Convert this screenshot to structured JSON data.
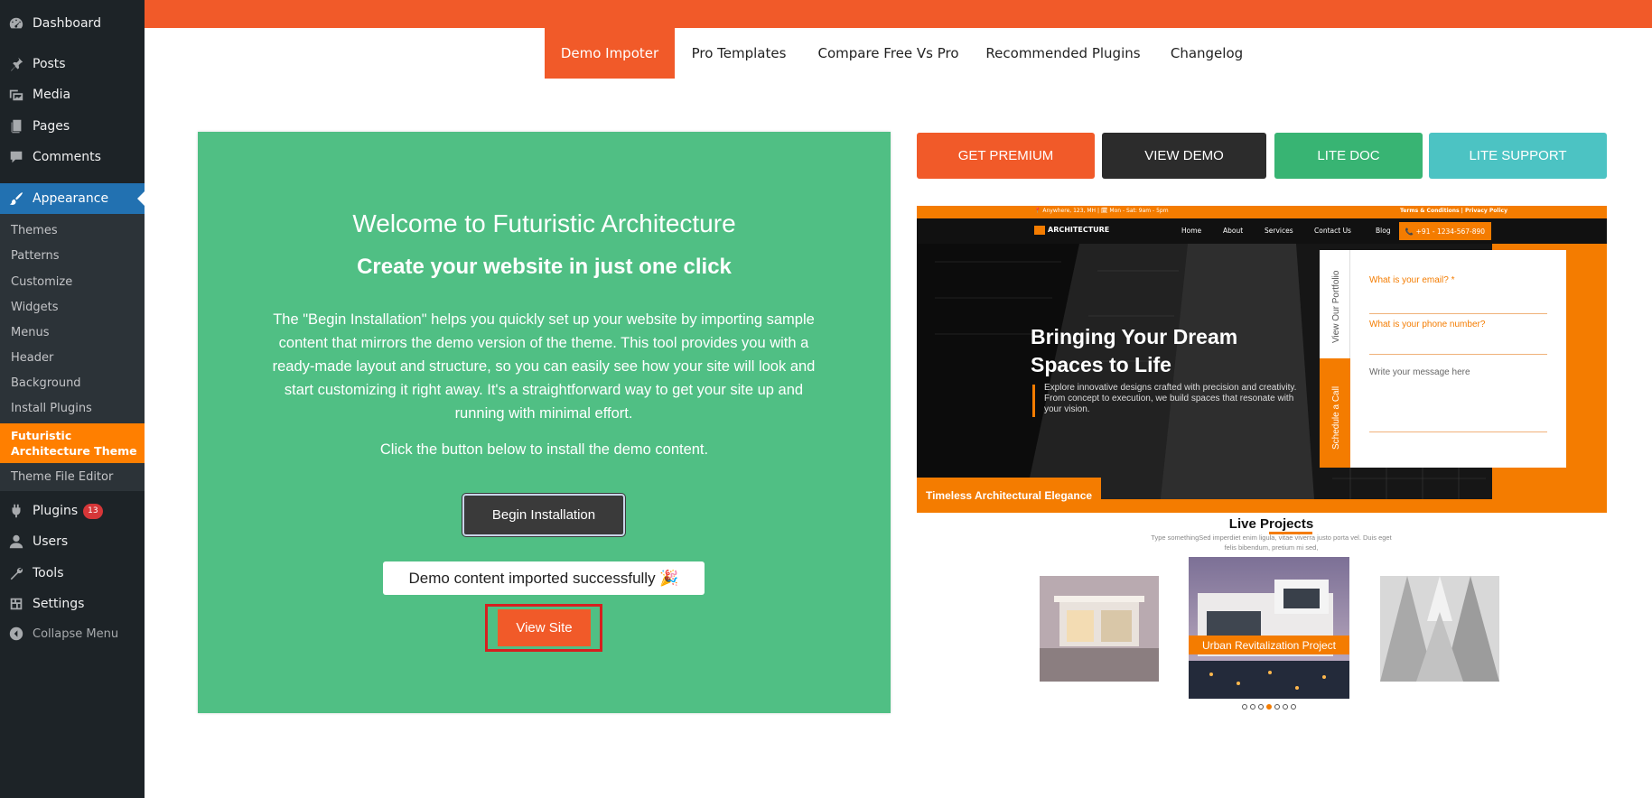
{
  "sidebar": {
    "items": [
      {
        "label": "Dashboard",
        "icon": "dashboard-icon"
      },
      {
        "label": "Posts",
        "icon": "pin-icon"
      },
      {
        "label": "Media",
        "icon": "media-icon"
      },
      {
        "label": "Pages",
        "icon": "pages-icon"
      },
      {
        "label": "Comments",
        "icon": "comment-icon"
      },
      {
        "label": "Appearance",
        "icon": "brush-icon",
        "active": true
      }
    ],
    "submenu": [
      "Themes",
      "Patterns",
      "Customize",
      "Widgets",
      "Menus",
      "Header",
      "Background",
      "Install Plugins"
    ],
    "submenu_current": "Futuristic Architecture Theme",
    "submenu_after": "Theme File Editor",
    "items_lower": [
      {
        "label": "Plugins",
        "icon": "plugin-icon",
        "badge": "13"
      },
      {
        "label": "Users",
        "icon": "user-icon"
      },
      {
        "label": "Tools",
        "icon": "wrench-icon"
      },
      {
        "label": "Settings",
        "icon": "settings-icon"
      }
    ],
    "collapse_label": "Collapse Menu"
  },
  "tabs": [
    "Demo Impoter",
    "Pro Templates",
    "Compare Free Vs Pro",
    "Recommended Plugins",
    "Changelog"
  ],
  "active_tab": "Demo Impoter",
  "panel": {
    "title": "Welcome to Futuristic Architecture",
    "subtitle": "Create your website in just one click",
    "description": "The \"Begin Installation\" helps you quickly set up your website by importing sample content that mirrors the demo version of the theme. This tool provides you with a ready-made layout and structure, so you can easily see how your site will look and start customizing it right away. It's a straightforward way to get your site up and running with minimal effort.",
    "click_text": "Click the button below to install the demo content.",
    "begin_button": "Begin Installation",
    "success_message": "Demo content imported successfully 🎉",
    "view_site_button": "View Site"
  },
  "actions": [
    {
      "label": "GET PREMIUM",
      "color": "#f15a29"
    },
    {
      "label": "VIEW DEMO",
      "color": "#2c2c2c"
    },
    {
      "label": "LITE DOC",
      "color": "#38b473"
    },
    {
      "label": "LITE SUPPORT",
      "color": "#4cc3c3"
    }
  ],
  "preview": {
    "topbar_left": "📍 Anywhere, 123, MH  |  🗓 Mon - Sat: 9am - 5pm",
    "topbar_right": "Terms & Conditions | Privacy Policy",
    "logo": "ARCHITECTURE",
    "nav": [
      "Home",
      "About",
      "Services",
      "Contact Us",
      "Blog"
    ],
    "phone_button": "📞 +91 - 1234-567-890",
    "heading": "Bringing Your Dream Spaces to Life",
    "copy": "Explore innovative designs crafted with precision and creativity. From concept to execution, we build spaces that resonate with your vision.",
    "form_labels": [
      "What is your email? *",
      "What is your phone number?",
      "Write your message here"
    ],
    "vertical_tab_1": "View Our Portfolio",
    "vertical_tab_2": "Schedule a Call",
    "caption": "Timeless Architectural Elegance",
    "live_title": "Live Projects",
    "live_desc": "Type somethingSed imperdiet enim ligula, vitae viverra justo porta vel. Duis eget felis bibendum, pretium mi sed,",
    "project_caption": "Urban Revitalization Project"
  },
  "colors": {
    "accent": "#f15a29",
    "panel_green": "#50bf84",
    "wp_sidebar": "#1d2327",
    "wp_active": "#2271b1",
    "theme_orange": "#f47c00"
  }
}
